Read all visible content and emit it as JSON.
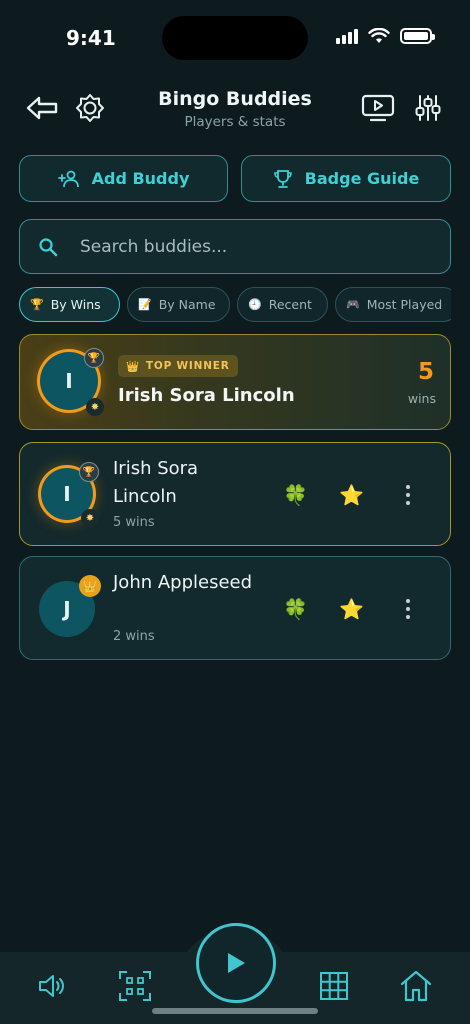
{
  "status_bar": {
    "time": "9:41"
  },
  "header": {
    "title": "Bingo Buddies",
    "subtitle": "Players & stats",
    "back_icon": "arrow-left-icon",
    "theme_icon": "sun-gear-icon",
    "tv_icon": "tv-play-icon",
    "settings_icon": "sliders-icon"
  },
  "actions": {
    "add_buddy_label": "Add Buddy",
    "badge_guide_label": "Badge Guide"
  },
  "search": {
    "placeholder": "Search buddies..."
  },
  "sort_chips": [
    {
      "icon": "🏆",
      "label": "By Wins",
      "active": true
    },
    {
      "icon": "📝",
      "label": "By Name",
      "active": false
    },
    {
      "icon": "🕘",
      "label": "Recent",
      "active": false
    },
    {
      "icon": "🎮",
      "label": "Most Played",
      "active": false
    }
  ],
  "top_winner": {
    "tag": "TOP WINNER",
    "tag_icon": "👑",
    "initial": "I",
    "name": "Irish Sora Lincoln",
    "wins": "5",
    "wins_label": "wins",
    "badge_icon": "🏆",
    "sparkle_icon": "✸"
  },
  "buddies": [
    {
      "initial": "I",
      "name": "Irish Sora Lincoln",
      "wins_text": "5 wins",
      "badge_icon": "🏆",
      "sparkle_icon": "✸",
      "emoji_1": "🍀",
      "emoji_2": "⭐"
    },
    {
      "initial": "J",
      "name": "John Appleseed",
      "wins_text": "2 wins",
      "badge_icon": "👑",
      "emoji_1": "🍀",
      "emoji_2": "⭐"
    }
  ],
  "bottom_nav": {
    "sound_icon": "speaker-icon",
    "scan_icon": "qr-scan-icon",
    "play_icon": "play-icon",
    "grid_icon": "grid-icon",
    "home_icon": "home-icon"
  },
  "colors": {
    "accent": "#3fd0d6",
    "gold": "#f29a19",
    "background": "#0d1b1e"
  }
}
